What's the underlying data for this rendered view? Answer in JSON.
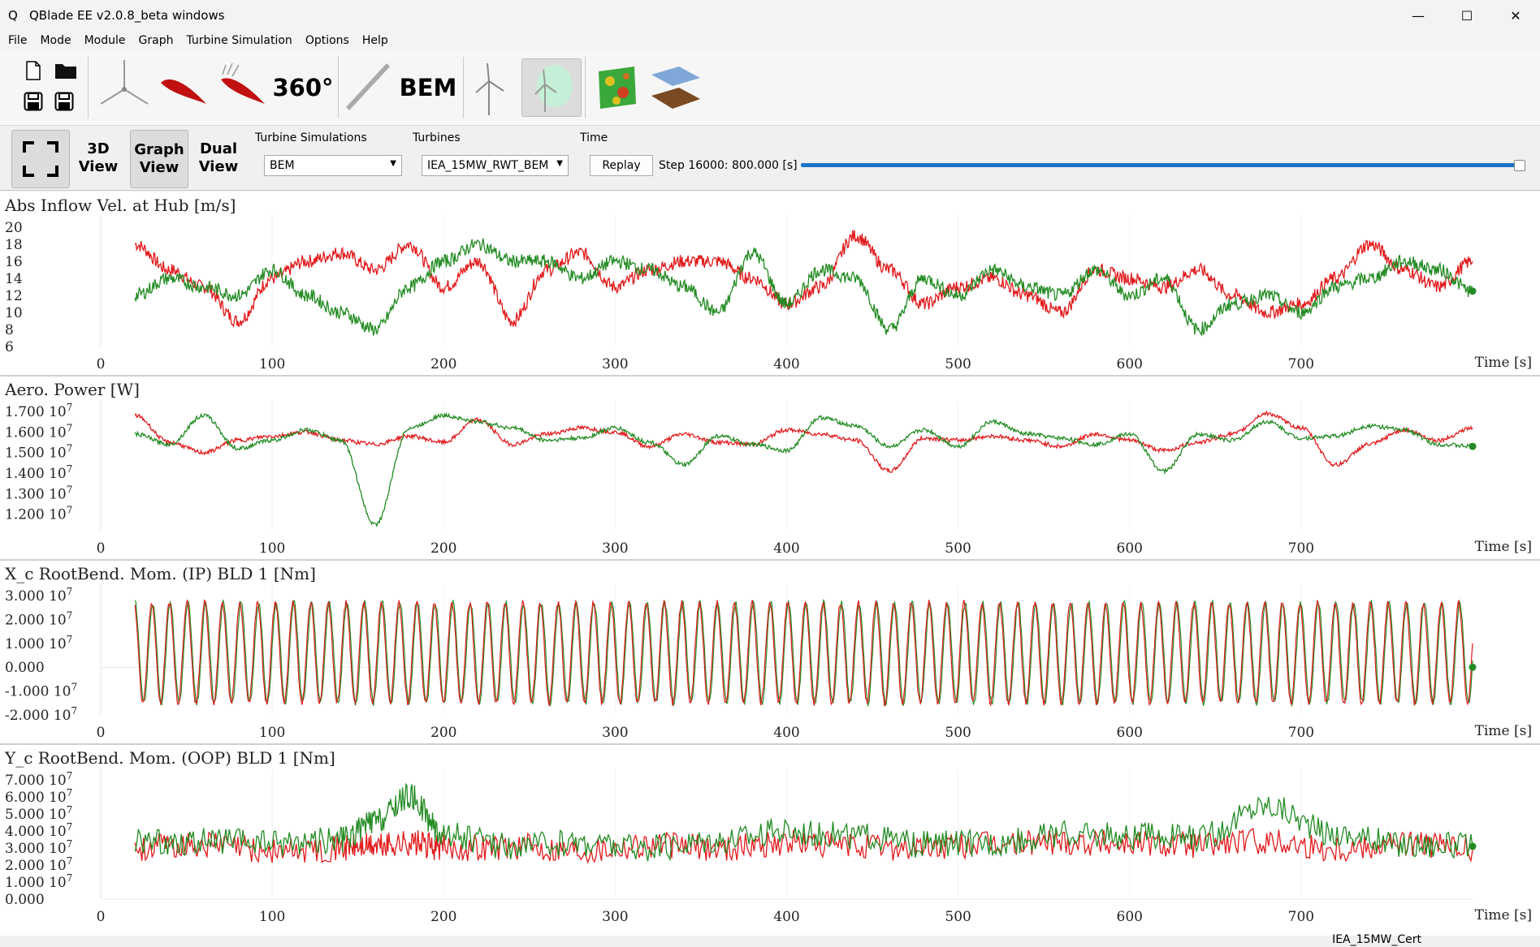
{
  "window": {
    "title": "QBlade EE v2.0.8_beta windows",
    "app_icon": "Q",
    "minimize": "—",
    "maximize": "☐",
    "close": "✕"
  },
  "menu": [
    "File",
    "Mode",
    "Module",
    "Graph",
    "Turbine Simulation",
    "Options",
    "Help"
  ],
  "toolbar": {
    "polar_360_label": "360°",
    "bem_label": "BEM"
  },
  "viewbar": {
    "view_3d": "3D View",
    "view_graph": "Graph View",
    "view_dual": "Dual View",
    "turbine_sim_label": "Turbine Simulations",
    "turbine_sim_value": "BEM",
    "turbines_label": "Turbines",
    "turbines_value": "IEA_15MW_RWT_BEM",
    "time_label": "Time",
    "replay_label": "Replay",
    "step_text": "Step 16000:  800.000 [s]",
    "time_progress": 1.0
  },
  "status": {
    "project": "IEA_15MW_Cert"
  },
  "colors": {
    "series_red": "#e31a1c",
    "series_green": "#238b23",
    "slider": "#1a73c8"
  },
  "chart_data": [
    {
      "type": "line",
      "title": "Abs Inflow Vel. at Hub [m/s]",
      "xlabel": "Time [s]",
      "xlim": [
        0,
        800
      ],
      "ylim": [
        6,
        20
      ],
      "xticks": [
        "0",
        "100",
        "200",
        "300",
        "400",
        "500",
        "600",
        "700"
      ],
      "yticks": [
        "6",
        "8",
        "10",
        "12",
        "14",
        "16",
        "18",
        "20"
      ],
      "series": [
        {
          "color": "red",
          "x": [
            20,
            40,
            60,
            80,
            100,
            120,
            140,
            160,
            180,
            200,
            220,
            240,
            260,
            280,
            300,
            320,
            340,
            360,
            380,
            400,
            420,
            440,
            460,
            480,
            500,
            520,
            540,
            560,
            580,
            600,
            620,
            640,
            660,
            680,
            700,
            720,
            740,
            760,
            780,
            800
          ],
          "y": [
            18,
            15,
            13,
            9,
            14,
            16,
            17,
            15,
            18,
            13,
            16,
            9,
            15,
            17,
            13,
            15,
            16,
            16,
            14,
            11,
            13,
            19,
            15,
            11,
            13,
            14,
            12,
            10,
            15,
            14,
            13,
            15,
            12,
            10,
            11,
            14,
            18,
            15,
            13,
            16
          ]
        },
        {
          "color": "green",
          "x": [
            20,
            40,
            60,
            80,
            100,
            120,
            140,
            160,
            180,
            200,
            220,
            240,
            260,
            280,
            300,
            320,
            340,
            360,
            380,
            400,
            420,
            440,
            460,
            480,
            500,
            520,
            540,
            560,
            580,
            600,
            620,
            640,
            660,
            680,
            700,
            720,
            740,
            760,
            780,
            800
          ],
          "y": [
            12,
            14,
            13,
            12,
            15,
            12,
            10,
            8,
            13,
            16,
            18,
            16,
            16,
            14,
            16,
            15,
            13,
            10,
            17,
            11,
            15,
            14,
            8,
            14,
            12,
            15,
            13,
            12,
            15,
            12,
            14,
            8,
            11,
            12,
            10,
            13,
            14,
            16,
            15,
            12.5
          ]
        }
      ]
    },
    {
      "type": "line",
      "title": "Aero. Power [W]",
      "xlabel": "Time [s]",
      "xlim": [
        0,
        800
      ],
      "ylim": [
        11200000,
        17000000
      ],
      "xticks": [
        "0",
        "100",
        "200",
        "300",
        "400",
        "500",
        "600",
        "700"
      ],
      "yticks": [
        "1.200 10^7",
        "1.300 10^7",
        "1.400 10^7",
        "1.500 10^7",
        "1.600 10^7",
        "1.700 10^7"
      ],
      "series": [
        {
          "color": "red",
          "x": [
            20,
            40,
            60,
            80,
            100,
            120,
            140,
            160,
            180,
            200,
            220,
            240,
            260,
            280,
            300,
            320,
            340,
            360,
            380,
            400,
            420,
            440,
            460,
            480,
            500,
            520,
            540,
            560,
            580,
            600,
            620,
            640,
            660,
            680,
            700,
            720,
            740,
            760,
            780,
            800
          ],
          "y": [
            16.8,
            15.5,
            15.0,
            15.6,
            15.8,
            16.0,
            15.6,
            15.4,
            15.8,
            15.5,
            16.6,
            15.4,
            15.9,
            16.2,
            16.0,
            15.3,
            15.9,
            15.5,
            15.4,
            16.1,
            15.9,
            15.6,
            14.1,
            15.7,
            15.6,
            15.8,
            15.6,
            15.3,
            15.9,
            15.6,
            15.1,
            15.5,
            15.9,
            16.9,
            16.2,
            14.4,
            15.4,
            16.1,
            15.6,
            16.2
          ]
        },
        {
          "color": "green",
          "x": [
            20,
            40,
            60,
            80,
            100,
            120,
            140,
            160,
            180,
            200,
            220,
            240,
            260,
            280,
            300,
            320,
            340,
            360,
            380,
            400,
            420,
            440,
            460,
            480,
            500,
            520,
            540,
            560,
            580,
            600,
            620,
            640,
            660,
            680,
            700,
            720,
            740,
            760,
            780,
            800
          ],
          "y": [
            15.9,
            15.4,
            16.8,
            15.2,
            15.6,
            16.1,
            15.6,
            11.5,
            16.2,
            16.8,
            16.5,
            16.2,
            15.6,
            15.7,
            16.2,
            15.5,
            14.4,
            15.8,
            15.4,
            15.1,
            16.7,
            16.3,
            15.3,
            16.1,
            15.3,
            16.5,
            15.9,
            15.7,
            15.4,
            15.9,
            14.1,
            15.9,
            15.6,
            16.5,
            15.7,
            15.8,
            16.3,
            16.1,
            15.4,
            15.3
          ]
        }
      ]
    },
    {
      "type": "line",
      "title": "X_c RootBend. Mom. (IP) BLD 1 [Nm]",
      "xlabel": "Time [s]",
      "xlim": [
        0,
        800
      ],
      "ylim": [
        -20000000,
        30000000
      ],
      "xticks": [
        "0",
        "100",
        "200",
        "300",
        "400",
        "500",
        "600",
        "700"
      ],
      "yticks": [
        "-2.000 10^7",
        "-1.000 10^7",
        "0.000",
        "1.000 10^7",
        "2.000 10^7",
        "3.000 10^7"
      ],
      "oscillation": {
        "period_s": 10.3,
        "min": -15000000,
        "max": 27000000,
        "start_s": 20,
        "end_s": 800
      }
    },
    {
      "type": "line",
      "title": "Y_c RootBend. Mom. (OOP) BLD 1 [Nm]",
      "xlabel": "Time [s]",
      "xlim": [
        0,
        800
      ],
      "ylim": [
        0,
        70000000
      ],
      "xticks": [
        "0",
        "100",
        "200",
        "300",
        "400",
        "500",
        "600",
        "700"
      ],
      "yticks": [
        "0.000",
        "1.000 10^7",
        "2.000 10^7",
        "3.000 10^7",
        "4.000 10^7",
        "5.000 10^7",
        "6.000 10^7",
        "7.000 10^7"
      ],
      "series": [
        {
          "color": "red",
          "x": [
            20,
            60,
            100,
            140,
            160,
            180,
            200,
            240,
            280,
            320,
            360,
            400,
            440,
            480,
            520,
            560,
            600,
            640,
            680,
            720,
            760,
            800
          ],
          "y": [
            30,
            32,
            28,
            30,
            31,
            33,
            30,
            31,
            29,
            32,
            30,
            33,
            31,
            30,
            32,
            34,
            33,
            32,
            34,
            30,
            33,
            29
          ]
        },
        {
          "color": "green",
          "x": [
            20,
            60,
            100,
            140,
            160,
            180,
            200,
            240,
            280,
            320,
            360,
            400,
            440,
            480,
            520,
            560,
            600,
            640,
            680,
            720,
            760,
            800
          ],
          "y": [
            33,
            34,
            33,
            35,
            45,
            60,
            38,
            31,
            33,
            30,
            35,
            40,
            37,
            32,
            33,
            38,
            37,
            36,
            55,
            38,
            32,
            31
          ]
        }
      ]
    }
  ]
}
